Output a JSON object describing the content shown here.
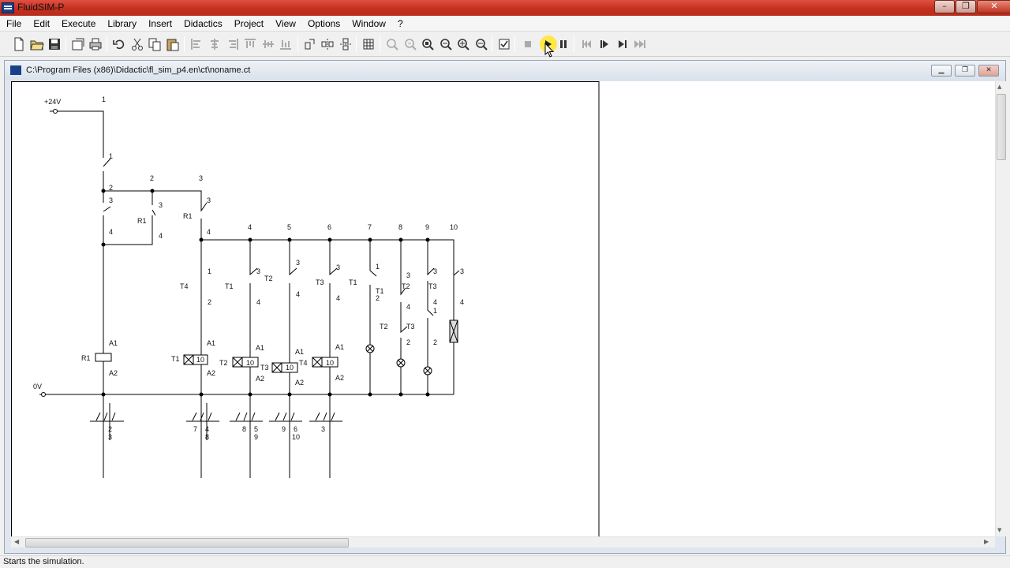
{
  "window": {
    "title": "FluidSIM-P"
  },
  "menu": [
    "File",
    "Edit",
    "Execute",
    "Library",
    "Insert",
    "Didactics",
    "Project",
    "View",
    "Options",
    "Window",
    "?"
  ],
  "document": {
    "path": "C:\\Program Files (x86)\\Didactic\\fl_sim_p4.en\\ct\\noname.ct"
  },
  "status": {
    "text": "Starts the simulation."
  },
  "circuit": {
    "supply": "+24V",
    "ground": "0V",
    "column_numbers": [
      "1",
      "2",
      "3",
      "4",
      "5",
      "6",
      "7",
      "8",
      "9",
      "10"
    ],
    "contact_terms": {
      "c1": "1",
      "c2": "2",
      "c3": "3",
      "c4": "4"
    },
    "relay_tag": "R1",
    "timers": [
      "T1",
      "T2",
      "T3",
      "T4"
    ],
    "timer_value": "10",
    "coil_terms": {
      "a1": "A1",
      "a2": "A2"
    },
    "contact_tables": [
      {
        "left": "",
        "right": [
          "2",
          "3"
        ]
      },
      {
        "left": "7",
        "right": [
          "4",
          "8"
        ]
      },
      {
        "left": "8",
        "right": [
          "5",
          "9"
        ]
      },
      {
        "left": "9",
        "right": [
          "6",
          "10"
        ]
      },
      {
        "left": "3",
        "right": []
      }
    ]
  }
}
